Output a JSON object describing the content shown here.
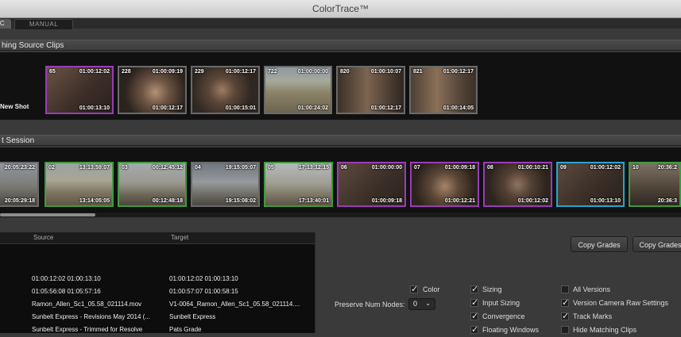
{
  "window": {
    "title": "ColorTrace™"
  },
  "tabs": [
    {
      "label": "C",
      "active": true
    },
    {
      "label": "MANUAL",
      "active": false
    }
  ],
  "matching": {
    "header": "hing Source Clips",
    "side_label": "New Shot",
    "clips": [
      {
        "number": "65",
        "tc_start": "01:00:12:02",
        "tc_end": "01:00:13:10",
        "border": "purple"
      },
      {
        "number": "228",
        "tc_start": "01:00:09:19",
        "tc_end": "01:00:12:17",
        "border": "gray"
      },
      {
        "number": "229",
        "tc_start": "01:00:12:17",
        "tc_end": "01:00:15:01",
        "border": "gray"
      },
      {
        "number": "722",
        "tc_start": "01:00:00:00",
        "tc_end": "01:00:24:02",
        "border": "gray"
      },
      {
        "number": "820",
        "tc_start": "01:00:10:07",
        "tc_end": "01:00:12:17",
        "border": "gray"
      },
      {
        "number": "821",
        "tc_start": "01:00:12:17",
        "tc_end": "01:00:14:05",
        "border": "gray"
      }
    ]
  },
  "session": {
    "header": "t Session",
    "clips": [
      {
        "number": "",
        "tc_start": "20:05:23:22",
        "tc_end": "20:05:29:18",
        "border": "gray"
      },
      {
        "number": "02",
        "tc_start": "13:13:59:07",
        "tc_end": "13:14:05:05",
        "border": "green"
      },
      {
        "number": "03",
        "tc_start": "00:12:45:12",
        "tc_end": "00:12:48:18",
        "border": "green"
      },
      {
        "number": "04",
        "tc_start": "19:15:05:07",
        "tc_end": "19:15:08:02",
        "border": "gray"
      },
      {
        "number": "05",
        "tc_start": "17:13:12:15",
        "tc_end": "17:13:40:01",
        "border": "green"
      },
      {
        "number": "06",
        "tc_start": "01:00:00:00",
        "tc_end": "01:00:09:18",
        "border": "purple"
      },
      {
        "number": "07",
        "tc_start": "01:00:09:18",
        "tc_end": "01:00:12:21",
        "border": "purple"
      },
      {
        "number": "08",
        "tc_start": "01:00:10:21",
        "tc_end": "01:00:12:02",
        "border": "purple"
      },
      {
        "number": "09",
        "tc_start": "01:00:12:02",
        "tc_end": "01:00:13:10",
        "border": "cyan"
      },
      {
        "number": "10",
        "tc_start": "20:36:2",
        "tc_end": "20:36:3",
        "border": "green"
      }
    ]
  },
  "table": {
    "headers": {
      "source": "Source",
      "target": "Target"
    },
    "rows": [
      {
        "source": "01:00:12:02   01:00:13:10",
        "target": "01:00:12:02   01:00:13:10"
      },
      {
        "source": "01:05:56:08   01:05:57:16",
        "target": "01:00:57:07   01:00:58:15"
      },
      {
        "source": "Ramon_Allen_Sc1_05.58_021114.mov",
        "target": "V1-0064_Ramon_Allen_Sc1_05.58_021114...."
      },
      {
        "source": "Sunbelt Express - Revisions May 2014 (...",
        "target": "Sunbelt Express"
      },
      {
        "source": "Sunbelt Express - Trimmed for Resolve",
        "target": "Pats Grade"
      }
    ]
  },
  "buttons": {
    "copy_grades_1": "Copy Grades",
    "copy_grades_2": "Copy Grades"
  },
  "options": {
    "preserve_label": "Preserve Num Nodes:",
    "preserve_value": "0",
    "color": "Color",
    "sizing": "Sizing",
    "input_sizing": "Input Sizing",
    "convergence": "Convergence",
    "floating_windows": "Floating Windows",
    "all_versions": "All Versions",
    "version_camera_raw": "Version Camera Raw Settings",
    "track_marks": "Track Marks",
    "hide_matching": "Hide Matching Clips"
  }
}
